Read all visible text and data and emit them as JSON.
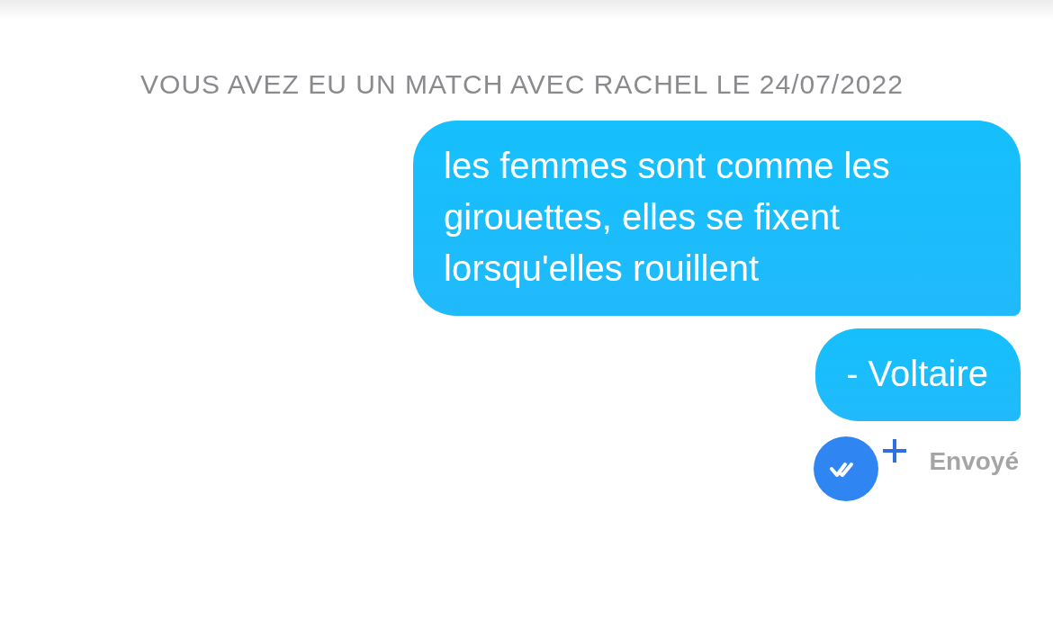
{
  "match_notice": "VOUS AVEZ EU UN MATCH AVEC RACHEL LE 24/07/2022",
  "messages": [
    {
      "text": "les femmes sont comme les girouettes, elles se fixent lorsqu'elles rouillent"
    },
    {
      "text": "- Voltaire"
    }
  ],
  "status": {
    "text": "Envoyé"
  }
}
